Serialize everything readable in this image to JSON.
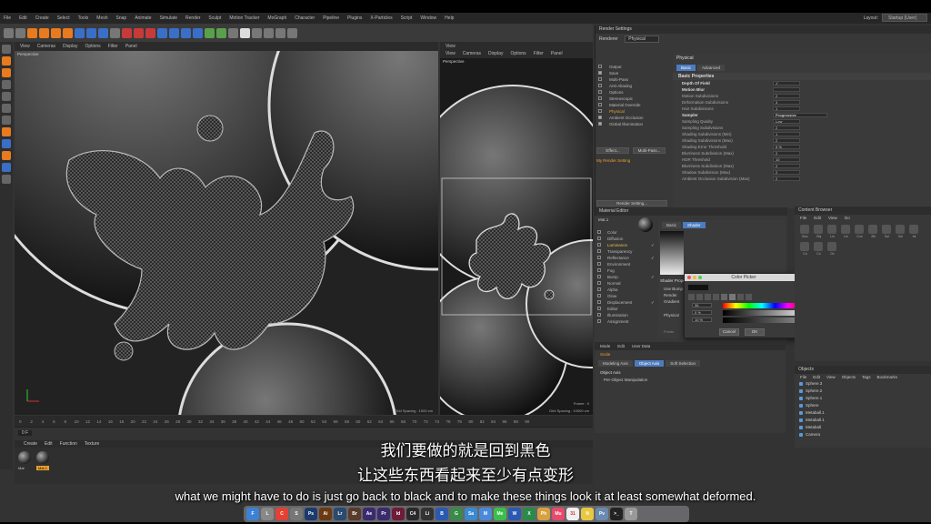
{
  "menubar": {
    "items": [
      "File",
      "Edit",
      "Create",
      "Select",
      "Tools",
      "Mesh",
      "Snap",
      "Animate",
      "Simulate",
      "Render",
      "Sculpt",
      "Motion Tracker",
      "MoGraph",
      "Character",
      "Pipeline",
      "Plugins",
      "X-Particles",
      "Script",
      "Window",
      "Help"
    ],
    "layout_label": "Layout:",
    "layout_value": "Startup (User)"
  },
  "viewport_left": {
    "menu": [
      "View",
      "Cameras",
      "Display",
      "Options",
      "Filter",
      "Panel"
    ],
    "label": "Perspective",
    "grid": "Grid Spacing : 1000 cm"
  },
  "viewport_right": {
    "title": "View",
    "menu": [
      "View",
      "Cameras",
      "Display",
      "Options",
      "Filter",
      "Panel"
    ],
    "label": "Perspective",
    "frame": "Frame : 0",
    "grid": "Grid Spacing : 10000 cm"
  },
  "timeline": {
    "ticks": [
      "0",
      "2",
      "4",
      "6",
      "8",
      "10",
      "12",
      "14",
      "16",
      "18",
      "20",
      "22",
      "24",
      "26",
      "28",
      "30",
      "32",
      "34",
      "36",
      "38",
      "40",
      "42",
      "44",
      "46",
      "48",
      "50",
      "52",
      "54",
      "56",
      "58",
      "60",
      "62",
      "64",
      "66",
      "68",
      "70",
      "72",
      "74",
      "76",
      "78",
      "80",
      "82",
      "84",
      "86",
      "88",
      "90"
    ],
    "frame_field": "0 F"
  },
  "material_manager": {
    "menu": [
      "Create",
      "Edit",
      "Function",
      "Texture"
    ],
    "materials": [
      "Mat",
      "Mat.1"
    ]
  },
  "render_settings": {
    "title": "Render Settings",
    "renderer_label": "Renderer",
    "renderer_value": "Physical",
    "items": [
      {
        "label": "Output",
        "checked": false
      },
      {
        "label": "Save",
        "checked": true
      },
      {
        "label": "Multi-Pass",
        "checked": false
      },
      {
        "label": "Anti-Aliasing",
        "checked": false
      },
      {
        "label": "Options",
        "checked": false
      },
      {
        "label": "Stereoscopic",
        "checked": false
      },
      {
        "label": "Material Override",
        "checked": false
      },
      {
        "label": "Physical",
        "checked": false,
        "highlight": true
      },
      {
        "label": "Ambient Occlusion",
        "checked": true
      },
      {
        "label": "Global Illumination",
        "checked": true
      }
    ],
    "effect_button": "Effect...",
    "multipass_button": "Multi-Pass...",
    "my_setting": "My Render Setting",
    "render_setting_button": "Render Setting...",
    "panel_title": "Physical",
    "tabs": [
      "Basic",
      "Advanced"
    ],
    "basic_section": "Basic Properties",
    "properties": [
      {
        "label": "Depth Of Field",
        "value": "✓",
        "head": true
      },
      {
        "label": "Motion Blur",
        "value": "",
        "head": true
      },
      {
        "label": "Motion Subdivisions",
        "value": "2"
      },
      {
        "label": "Deformation Subdivisions",
        "value": "3"
      },
      {
        "label": "Hair Subdivisions",
        "value": "1"
      }
    ],
    "sampler_label": "Sampler",
    "sampler_value": "Progressive",
    "sampler_props": [
      {
        "label": "Sampling Quality",
        "value": "Low"
      },
      {
        "label": "Sampling Subdivisions",
        "value": "2"
      },
      {
        "label": "Shading Subdivisions (Min)",
        "value": "1"
      },
      {
        "label": "Shading Subdivisions (Max)",
        "value": "2"
      },
      {
        "label": "Shading Error Threshold",
        "value": "5 %"
      },
      {
        "label": "Blurriness Subdivision (Max)",
        "value": "2"
      },
      {
        "label": "HDR Threshold",
        "value": "10"
      }
    ],
    "bottom_props": [
      {
        "label": "Blurriness Subdivision (Max)",
        "value": "2"
      },
      {
        "label": "Shadow Subdivision (Max)",
        "value": "2"
      },
      {
        "label": "Ambient Occlusion Subdivision (Max)",
        "value": "2"
      }
    ]
  },
  "material_editor": {
    "title": "Material Editor",
    "mat_name": "Mat.1",
    "channels": [
      {
        "label": "Color",
        "on": false
      },
      {
        "label": "Diffusion",
        "on": false
      },
      {
        "label": "Luminance",
        "on": true,
        "highlight": true
      },
      {
        "label": "Transparency",
        "on": false
      },
      {
        "label": "Reflectance",
        "on": true
      },
      {
        "label": "Environment",
        "on": false
      },
      {
        "label": "Fog",
        "on": false
      },
      {
        "label": "Bump",
        "on": true
      },
      {
        "label": "Normal",
        "on": false
      },
      {
        "label": "Alpha",
        "on": false
      },
      {
        "label": "Glow",
        "on": false
      },
      {
        "label": "Displacement",
        "on": true
      },
      {
        "label": "Editor",
        "on": false
      },
      {
        "label": "Illumination",
        "on": false
      },
      {
        "label": "Assignment",
        "on": false
      }
    ],
    "tabs": [
      "Basic",
      "Shader"
    ],
    "shader_props_label": "Shader Properties",
    "props": [
      "Use Bump",
      "Render",
      "Gradient"
    ],
    "physical_label": "Physical",
    "points_label": "Points"
  },
  "color_picker": {
    "title": "Color Picker",
    "h": "36",
    "s": "0 %",
    "v": "10 %",
    "cancel": "Cancel",
    "ok": "OK"
  },
  "content_browser": {
    "title": "Content Browser",
    "menu": [
      "File",
      "Edit",
      "View",
      "Go"
    ],
    "items": [
      "Boo",
      "Obj",
      "Lin",
      "Lin",
      "Con",
      "Bit",
      "Sol",
      "Sol",
      "Ini",
      "Co",
      "Co",
      "Oc"
    ]
  },
  "attributes": {
    "menu": [
      "Mode",
      "Edit",
      "User Data"
    ],
    "object_name": "Scale",
    "tabs": [
      "Modeling Axis",
      "Object Axis",
      "Soft Selection"
    ],
    "section": "Object Axis",
    "row": "Per-Object Manipulation"
  },
  "objects": {
    "title": "Objects",
    "menu": [
      "File",
      "Edit",
      "View",
      "Objects",
      "Tags",
      "Bookmarks"
    ],
    "rows": [
      "Sphere.3",
      "Sphere.2",
      "Sphere.1",
      "Sphere",
      "Metaball.1",
      "Metaball.1",
      "Metaball",
      "Camera"
    ]
  },
  "subtitles": {
    "cn_line1": "我们要做的就是回到黑色",
    "cn_line2": "让这些东西看起来至少有点变形",
    "en": "what we might have to do is just go back to black and to make these things look it at least somewhat deformed."
  },
  "dock": {
    "apps": [
      {
        "name": "Finder",
        "color": "#3b82d6",
        "label": "F"
      },
      {
        "name": "Launchpad",
        "color": "#888888",
        "label": "L"
      },
      {
        "name": "Chrome",
        "color": "#e34133",
        "label": "C"
      },
      {
        "name": "Settings",
        "color": "#777777",
        "label": "S"
      },
      {
        "name": "Photoshop",
        "color": "#1c3a6e",
        "label": "Ps"
      },
      {
        "name": "Illustrator",
        "color": "#6b3a12",
        "label": "Ai"
      },
      {
        "name": "Lightroom",
        "color": "#2a4a6e",
        "label": "Lr"
      },
      {
        "name": "Bridge",
        "color": "#5a3a2a",
        "label": "Br"
      },
      {
        "name": "After Effects",
        "color": "#3a2a6e",
        "label": "Ae"
      },
      {
        "name": "Premiere",
        "color": "#3a2a6e",
        "label": "Pr"
      },
      {
        "name": "InDesign",
        "color": "#6e1c3a",
        "label": "Id"
      },
      {
        "name": "Cinema 4D",
        "color": "#2a2a2a",
        "label": "C4"
      },
      {
        "name": "Lite",
        "color": "#333333",
        "label": "Li"
      },
      {
        "name": "Blue",
        "color": "#2a5ab0",
        "label": "B"
      },
      {
        "name": "Green",
        "color": "#3a8a4a",
        "label": "G"
      },
      {
        "name": "Safari",
        "color": "#3a8ad0",
        "label": "Sa"
      },
      {
        "name": "Mail",
        "color": "#4a8ad8",
        "label": "M"
      },
      {
        "name": "Messages",
        "color": "#3ac04a",
        "label": "Me"
      },
      {
        "name": "Word",
        "color": "#2a5ab0",
        "label": "W"
      },
      {
        "name": "Excel",
        "color": "#2a8a4a",
        "label": "X"
      },
      {
        "name": "Photos",
        "color": "#d8a040",
        "label": "Ph"
      },
      {
        "name": "Music",
        "color": "#e84a6a",
        "label": "Mu"
      },
      {
        "name": "Calendar",
        "color": "#f0f0f0",
        "label": "31"
      },
      {
        "name": "Notes",
        "color": "#e8c840",
        "label": "N"
      },
      {
        "name": "Preview",
        "color": "#6a8ab0",
        "label": "Pv"
      },
      {
        "name": "Terminal",
        "color": "#222222",
        "label": ">_"
      },
      {
        "name": "Trash",
        "color": "#999999",
        "label": "T"
      }
    ]
  }
}
